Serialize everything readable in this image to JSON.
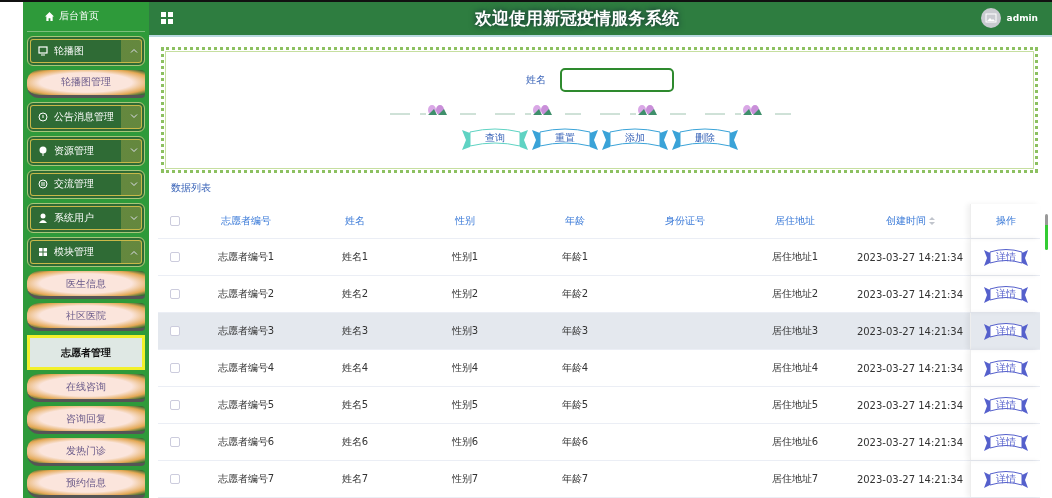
{
  "header": {
    "title": "欢迎使用新冠疫情服务系统",
    "user": "admin"
  },
  "sidebar": {
    "home": "后台首页",
    "groups": [
      {
        "label": "轮播图",
        "expanded": true,
        "children": [
          {
            "label": "轮播图管理",
            "selected": false
          }
        ]
      },
      {
        "label": "公告消息管理",
        "expanded": false
      },
      {
        "label": "资源管理",
        "expanded": false
      },
      {
        "label": "交流管理",
        "expanded": false
      },
      {
        "label": "系统用户",
        "expanded": false
      },
      {
        "label": "模块管理",
        "expanded": true,
        "children": [
          {
            "label": "医生信息",
            "selected": false
          },
          {
            "label": "社区医院",
            "selected": false
          },
          {
            "label": "志愿者管理",
            "selected": true
          },
          {
            "label": "在线咨询",
            "selected": false
          },
          {
            "label": "咨询回复",
            "selected": false
          },
          {
            "label": "发热门诊",
            "selected": false
          },
          {
            "label": "预约信息",
            "selected": false
          }
        ]
      }
    ]
  },
  "search": {
    "label": "姓名",
    "buttons": [
      "查询",
      "重置",
      "添加",
      "删除"
    ]
  },
  "list_title": "数据列表",
  "table": {
    "select_all_checked": false,
    "columns": [
      "志愿者编号",
      "姓名",
      "性别",
      "年龄",
      "身份证号",
      "居住地址",
      "创建时间",
      "操作"
    ],
    "rows": [
      {
        "checked": false,
        "hovered": false,
        "cells": [
          "志愿者编号1",
          "姓名1",
          "性别1",
          "年龄1",
          "",
          "居住地址1",
          "2023-03-27 14:21:34"
        ],
        "action": "详情"
      },
      {
        "checked": false,
        "hovered": false,
        "cells": [
          "志愿者编号2",
          "姓名2",
          "性别2",
          "年龄2",
          "",
          "居住地址2",
          "2023-03-27 14:21:34"
        ],
        "action": "详情"
      },
      {
        "checked": false,
        "hovered": true,
        "cells": [
          "志愿者编号3",
          "姓名3",
          "性别3",
          "年龄3",
          "",
          "居住地址3",
          "2023-03-27 14:21:34"
        ],
        "action": "详情"
      },
      {
        "checked": false,
        "hovered": false,
        "cells": [
          "志愿者编号4",
          "姓名4",
          "性别4",
          "年龄4",
          "",
          "居住地址4",
          "2023-03-27 14:21:34"
        ],
        "action": "详情"
      },
      {
        "checked": false,
        "hovered": false,
        "cells": [
          "志愿者编号5",
          "姓名5",
          "性别5",
          "年龄5",
          "",
          "居住地址5",
          "2023-03-27 14:21:34"
        ],
        "action": "详情"
      },
      {
        "checked": false,
        "hovered": false,
        "cells": [
          "志愿者编号6",
          "姓名6",
          "性别6",
          "年龄6",
          "",
          "居住地址6",
          "2023-03-27 14:21:34"
        ],
        "action": "详情"
      },
      {
        "checked": false,
        "hovered": false,
        "cells": [
          "志愿者编号7",
          "姓名7",
          "性别7",
          "年龄7",
          "",
          "居住地址7",
          "2023-03-27 14:21:34"
        ],
        "action": "详情"
      }
    ]
  }
}
